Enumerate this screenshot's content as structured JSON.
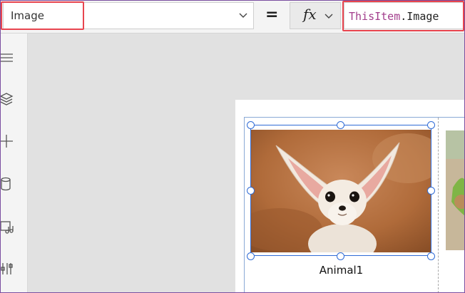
{
  "formula_bar": {
    "property": "Image",
    "equals": "=",
    "fx": "fx",
    "formula_keyword": "ThisItem",
    "formula_rest": ".Image"
  },
  "left_rail": {
    "icons": [
      "tree-view-icon",
      "layers-icon",
      "insert-icon",
      "data-icon",
      "media-icon",
      "tools-icon"
    ]
  },
  "gallery": {
    "items": [
      {
        "title": "Animal1",
        "image": "fennec-fox"
      },
      {
        "title": "",
        "image": "animal-2"
      }
    ]
  },
  "colors": {
    "highlight": "#e8454f",
    "selection": "#2f6bd6",
    "keyword": "#a23d8c"
  }
}
